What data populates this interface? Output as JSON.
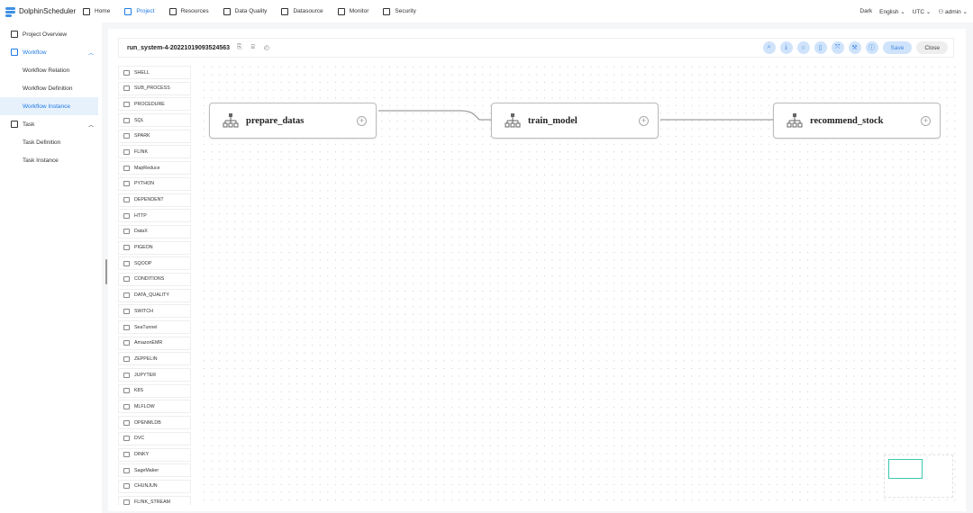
{
  "app": {
    "name": "DolphinScheduler"
  },
  "nav": [
    {
      "label": "Home",
      "icon": "home-icon"
    },
    {
      "label": "Project",
      "icon": "project-icon",
      "active": true
    },
    {
      "label": "Resources",
      "icon": "folder-icon"
    },
    {
      "label": "Data Quality",
      "icon": "data-quality-icon"
    },
    {
      "label": "Datasource",
      "icon": "database-icon"
    },
    {
      "label": "Monitor",
      "icon": "monitor-icon"
    },
    {
      "label": "Security",
      "icon": "shield-icon"
    }
  ],
  "header_right": {
    "theme": "Dark",
    "language": "English",
    "timezone": "UTC",
    "user": "admin"
  },
  "sidebar": {
    "items": [
      {
        "label": "Project Overview"
      },
      {
        "label": "Workflow"
      },
      {
        "label": "Workflow Relation"
      },
      {
        "label": "Workflow Definition"
      },
      {
        "label": "Workflow Instance"
      },
      {
        "label": "Task"
      },
      {
        "label": "Task Definition"
      },
      {
        "label": "Task Instance"
      }
    ]
  },
  "editor": {
    "title": "run_system-4-20221019093524563",
    "save": "Save",
    "close": "Close"
  },
  "tasks": [
    "SHELL",
    "SUB_PROCESS",
    "PROCEDURE",
    "SQL",
    "SPARK",
    "FLINK",
    "MapReduce",
    "PYTHON",
    "DEPENDENT",
    "HTTP",
    "DataX",
    "PIGEON",
    "SQOOP",
    "CONDITIONS",
    "DATA_QUALITY",
    "SWITCH",
    "SeaTunnel",
    "AmazonEMR",
    "ZEPPELIN",
    "JUPYTER",
    "K8S",
    "MLFLOW",
    "OPENMLDB",
    "DVC",
    "DINKY",
    "SageMaker",
    "CHUNJUN",
    "FLINK_STREAM"
  ],
  "nodes": [
    {
      "label": "prepare_datas"
    },
    {
      "label": "train_model"
    },
    {
      "label": "recommend_stock"
    }
  ],
  "colors": {
    "accent": "#1f7be6",
    "minimap": "#3cc8b0"
  }
}
